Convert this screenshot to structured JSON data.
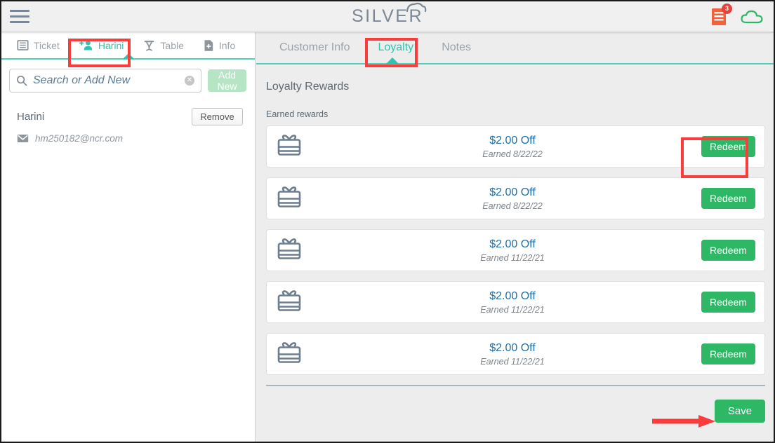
{
  "header": {
    "menu_icon": "hamburger-menu-icon",
    "logo_text": "SILVER",
    "logo_mark": "cloud-arc-icon",
    "receipt_icon": "receipt-icon",
    "receipt_badge": "3",
    "cloud_icon": "cloud-icon",
    "accent_teal": "#2ec4b0",
    "badge_red": "#e8413c",
    "receipt_orange": "#f0613c",
    "cloud_green": "#2eb866"
  },
  "left_panel": {
    "tabs": [
      {
        "label": "Ticket",
        "icon": "ticket-lines-icon",
        "active": false
      },
      {
        "label": "Harini",
        "icon": "add-person-icon",
        "active": true
      },
      {
        "label": "Table",
        "icon": "table-icon",
        "active": false
      },
      {
        "label": "Info",
        "icon": "document-plus-icon",
        "active": false
      }
    ],
    "search": {
      "icon": "search-icon",
      "placeholder": "Search or Add New",
      "value": "",
      "clear_icon": "clear-circle-icon"
    },
    "add_new_label": "Add New",
    "customer": {
      "name": "Harini",
      "remove_label": "Remove",
      "email_icon": "envelope-icon",
      "email": "hm250182@ncr.com"
    }
  },
  "main": {
    "tabs": [
      {
        "label": "Customer Info",
        "active": false
      },
      {
        "label": "Loyalty",
        "active": true
      },
      {
        "label": "Notes",
        "active": false
      }
    ],
    "section_title": "Loyalty Rewards",
    "sub_label": "Earned rewards",
    "redeem_label": "Redeem",
    "gift_icon": "gift-card-icon",
    "rewards": [
      {
        "amount": "$2.00 Off",
        "earned": "Earned 8/22/22"
      },
      {
        "amount": "$2.00 Off",
        "earned": "Earned 8/22/22"
      },
      {
        "amount": "$2.00 Off",
        "earned": "Earned 11/22/21"
      },
      {
        "amount": "$2.00 Off",
        "earned": "Earned 11/22/21"
      },
      {
        "amount": "$2.00 Off",
        "earned": "Earned 11/22/21"
      }
    ],
    "save_label": "Save"
  },
  "annotations": {
    "highlight_color": "#fa3c3c",
    "boxes": [
      "harini-tab",
      "loyalty-tab",
      "first-redeem-button"
    ],
    "arrow": "arrow-pointing-to-save-button"
  }
}
